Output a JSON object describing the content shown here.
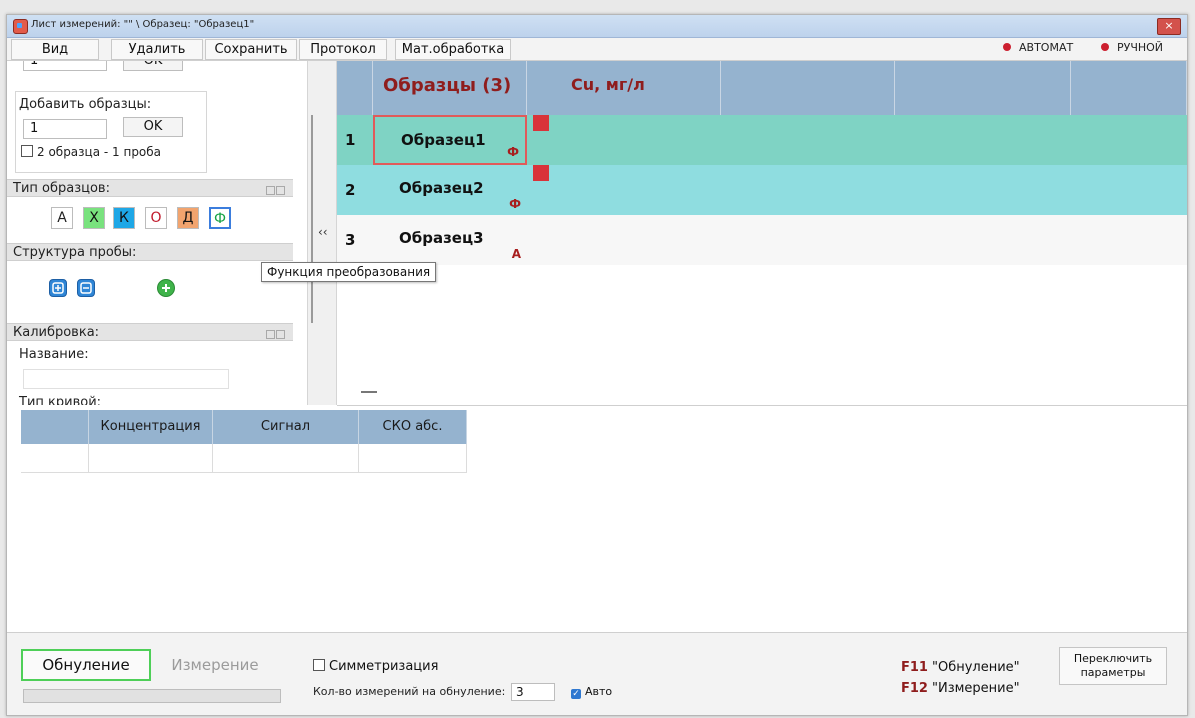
{
  "window": {
    "title": "Лист измерений: \"\" \\ Образец: \"Образец1\"",
    "close_icon": "×"
  },
  "menu": {
    "view": "Вид",
    "delete": "Удалить",
    "save": "Сохранить",
    "protocol": "Протокол",
    "math": "Мат.обработка"
  },
  "modes": {
    "auto": "АВТОМАТ",
    "manual": "РУЧНОЙ",
    "dot_color": "#cc1f2f"
  },
  "left": {
    "top_value": "1",
    "top_ok": "OK",
    "add_samples_label": "Добавить образцы:",
    "add_samples_value": "1",
    "add_ok": "OK",
    "two_samples_label": "2 образца - 1 проба",
    "sample_types_header": "Тип образцов:",
    "sample_type_buttons": [
      {
        "label": "А",
        "bg": "#ffffff",
        "color": "#222222"
      },
      {
        "label": "Х",
        "bg": "#79e27e",
        "color": "#111111"
      },
      {
        "label": "К",
        "bg": "#1ea7e6",
        "color": "#111111"
      },
      {
        "label": "О",
        "bg": "#ffffff",
        "color": "#c0182a"
      },
      {
        "label": "Д",
        "bg": "#f2a46e",
        "color": "#111111"
      },
      {
        "label": "Ф",
        "bg": "#ffffff",
        "color": "#17a345"
      }
    ],
    "probe_structure_header": "Структура пробы:",
    "calibration_header": "Калибровка:",
    "name_label": "Название:",
    "curve_type_label": "Тип кривой:",
    "collapse_arrow": "‹‹"
  },
  "grid": {
    "header_samples": "Образцы (3)",
    "header_cu": "Cu, мг/л",
    "rows": [
      {
        "num": "1",
        "name": "Образец1",
        "tag": "Ф",
        "bg": "#7fd3c4"
      },
      {
        "num": "2",
        "name": "Образец2",
        "tag": "Ф",
        "bg": "#8fdde0"
      },
      {
        "num": "3",
        "name": "Образец3",
        "tag": "А",
        "bg": "#f7f7f7"
      }
    ],
    "tooltip": "Функция преобразования"
  },
  "calibration_table": {
    "columns": [
      "Концентрация",
      "Сигнал",
      "СКО абс."
    ]
  },
  "bottom": {
    "zero_button": "Обнуление",
    "measure_button": "Измерение",
    "symmetrization_label": "Симметризация",
    "count_label": "Кол-во измерений на обнуление:",
    "count_value": "3",
    "auto_label": "Авто",
    "auto_checked": "✓",
    "f11_key": "F11",
    "f11_label": "\"Обнуление\"",
    "f12_key": "F12",
    "f12_label": "\"Измерение\"",
    "switch_button": "Переключить параметры",
    "progress": 0.0
  }
}
